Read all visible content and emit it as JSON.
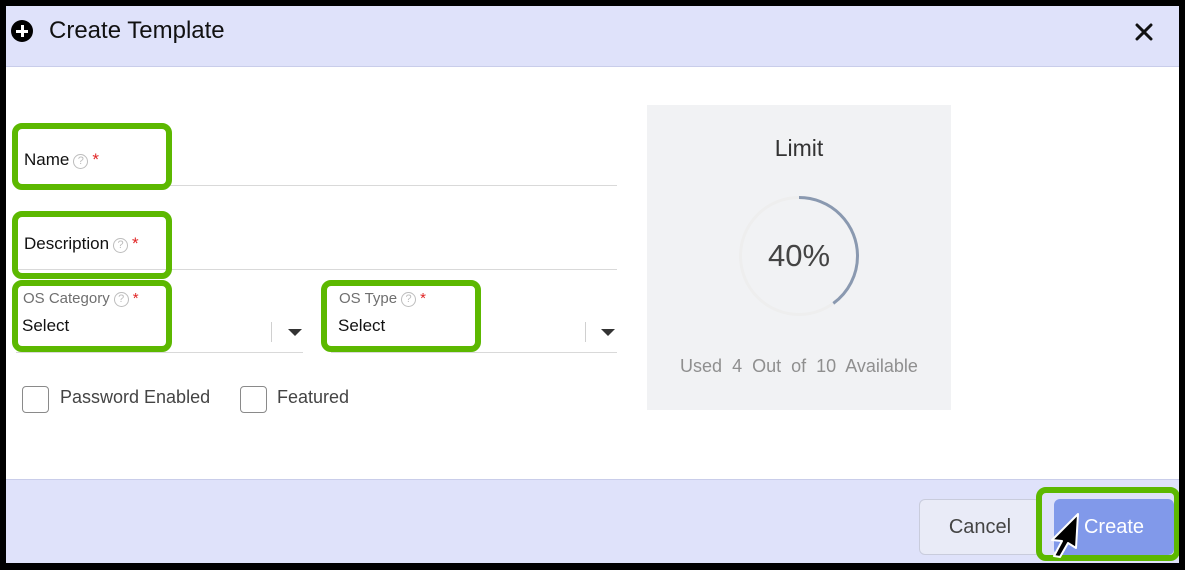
{
  "dialog": {
    "title": "Create Template",
    "icon": "plus-circle-icon",
    "close_icon": "close-icon"
  },
  "form": {
    "name": {
      "label": "Name",
      "help": "?",
      "required": "*",
      "value": ""
    },
    "description": {
      "label": "Description",
      "help": "?",
      "required": "*",
      "value": ""
    },
    "os_category": {
      "label": "OS Category",
      "help": "?",
      "required": "*",
      "value": "Select"
    },
    "os_type": {
      "label": "OS Type",
      "help": "?",
      "required": "*",
      "value": "Select"
    },
    "password_enabled": {
      "label": "Password Enabled",
      "checked": false
    },
    "featured": {
      "label": "Featured",
      "checked": false
    }
  },
  "limit": {
    "title": "Limit",
    "percent_label": "40%",
    "fraction": 0.4,
    "used_prefix": "Used",
    "used": "4",
    "out_of": "Out  of",
    "total": "10",
    "available": "Available"
  },
  "footer": {
    "cancel_label": "Cancel",
    "create_label": "Create"
  },
  "colors": {
    "header_bg": "#dfe2fa",
    "highlight": "#5cb800",
    "create_button": "#8199ea",
    "gauge_track": "#eeeeee",
    "gauge_fill": "#8a99b0",
    "required": "#e02424"
  }
}
